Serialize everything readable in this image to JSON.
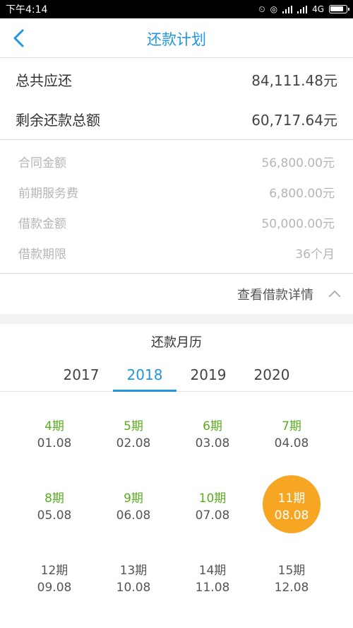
{
  "status": {
    "time": "下午4:14",
    "network": "4G"
  },
  "nav": {
    "title": "还款计划"
  },
  "summary": [
    {
      "label": "总共应还",
      "value": "84,111.48元"
    },
    {
      "label": "剩余还款总额",
      "value": "60,717.64元"
    }
  ],
  "details": [
    {
      "label": "合同金额",
      "value": "56,800.00元"
    },
    {
      "label": "前期服务费",
      "value": "6,800.00元"
    },
    {
      "label": "借款金额",
      "value": "50,000.00元"
    },
    {
      "label": "借款期限",
      "value": "36个月"
    }
  ],
  "more_label": "查看借款详情",
  "calendar": {
    "title": "还款月历",
    "years": [
      "2017",
      "2018",
      "2019",
      "2020"
    ],
    "active_year": "2018",
    "items": [
      {
        "period": "4期",
        "date": "01.08",
        "state": "paid"
      },
      {
        "period": "5期",
        "date": "02.08",
        "state": "paid"
      },
      {
        "period": "6期",
        "date": "03.08",
        "state": "paid"
      },
      {
        "period": "7期",
        "date": "04.08",
        "state": "paid"
      },
      {
        "period": "8期",
        "date": "05.08",
        "state": "paid"
      },
      {
        "period": "9期",
        "date": "06.08",
        "state": "paid"
      },
      {
        "period": "10期",
        "date": "07.08",
        "state": "paid"
      },
      {
        "period": "11期",
        "date": "08.08",
        "state": "current"
      },
      {
        "period": "12期",
        "date": "09.08",
        "state": "upcoming"
      },
      {
        "period": "13期",
        "date": "10.08",
        "state": "upcoming"
      },
      {
        "period": "14期",
        "date": "11.08",
        "state": "upcoming"
      },
      {
        "period": "15期",
        "date": "12.08",
        "state": "upcoming"
      }
    ]
  },
  "colors": {
    "accent": "#2196e0",
    "paid": "#5aab1e",
    "current": "#f6a623"
  }
}
